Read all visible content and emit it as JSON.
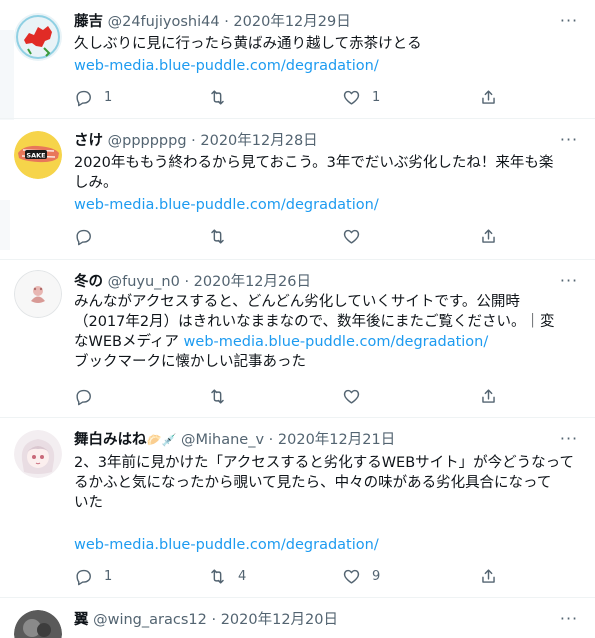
{
  "tweets": [
    {
      "name": "藤吉",
      "handle": "@24fujiyoshi44",
      "date": "2020年12月29日",
      "lines": [
        "久しぶりに見に行ったら黄ばみ通り越して赤茶けとる"
      ],
      "link": "web-media.blue-puddle.com/degradation/",
      "counts": {
        "reply": "1",
        "retweet": "",
        "like": "1"
      },
      "avatar_icon": "red-map-avatar-icon"
    },
    {
      "name": "さけ",
      "handle": "@ppppppg",
      "date": "2020年12月28日",
      "lines": [
        "2020年ももう終わるから見ておこう。3年でだいぶ劣化したね！来年も楽",
        "しみ。"
      ],
      "link": "web-media.blue-puddle.com/degradation/",
      "counts": {
        "reply": "",
        "retweet": "",
        "like": ""
      },
      "avatar_icon": "salmon-avatar-icon",
      "avatar_text": "SAKE"
    },
    {
      "name": "冬の",
      "handle": "@fuyu_n0",
      "date": "2020年12月26日",
      "lines": [
        "みんながアクセスすると、どんどん劣化していくサイトです。公開時",
        "（2017年2月）はきれいなままなので、数年後にまたご覧ください。｜変"
      ],
      "line3_prefix": "なWEBメディア ",
      "link": "web-media.blue-puddle.com/degradation/",
      "line4": "ブックマークに懐かしい記事あった",
      "counts": {
        "reply": "",
        "retweet": "",
        "like": ""
      },
      "avatar_icon": "pink-figure-avatar-icon"
    },
    {
      "name": "舞白みはね",
      "name_emoji": "🥟💉",
      "handle": "@Mihane_v",
      "date": "2020年12月21日",
      "lines": [
        "2、3年前に見かけた「アクセスすると劣化するWEBサイト」が今どうなって",
        "るかふと気になったから覗いて見たら、中々の味がある劣化具合になって",
        "いた"
      ],
      "link": "web-media.blue-puddle.com/degradation/",
      "counts": {
        "reply": "1",
        "retweet": "4",
        "like": "9"
      },
      "avatar_icon": "anime-girl-avatar-icon"
    },
    {
      "name": "翼",
      "handle": "@wing_aracs12",
      "date": "2020年12月20日",
      "lines": [],
      "avatar_icon": "dark-photo-avatar-icon"
    }
  ],
  "separator": "·",
  "more_label": "···",
  "colors": {
    "link": "#1d9bf0",
    "muted": "#536471",
    "text": "#0f1419",
    "divider": "#eff3f4"
  }
}
